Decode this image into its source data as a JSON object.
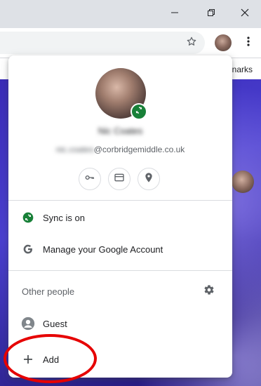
{
  "window": {
    "minimize_icon": "minimize-icon",
    "restore_icon": "restore-icon",
    "close_icon": "close-icon"
  },
  "toolbar": {
    "star_icon": "star-icon",
    "menu_icon": "kebab-menu-icon"
  },
  "bookmarks_bar": {
    "visible_text": "narks"
  },
  "profile_menu": {
    "name": "Nic Coates",
    "email_user": "nic.coates",
    "email_domain": "@corbridgemiddle.co.uk",
    "quick_actions": [
      {
        "name": "passwords",
        "icon": "key-icon"
      },
      {
        "name": "payment-methods",
        "icon": "credit-card-icon"
      },
      {
        "name": "addresses",
        "icon": "location-pin-icon"
      }
    ],
    "sync_label": "Sync is on",
    "manage_label": "Manage your Google Account",
    "other_people_label": "Other people",
    "guest_label": "Guest",
    "add_label": "Add",
    "sync_color": "#188038"
  },
  "annotation": {
    "color": "#e60000",
    "target": "add"
  }
}
